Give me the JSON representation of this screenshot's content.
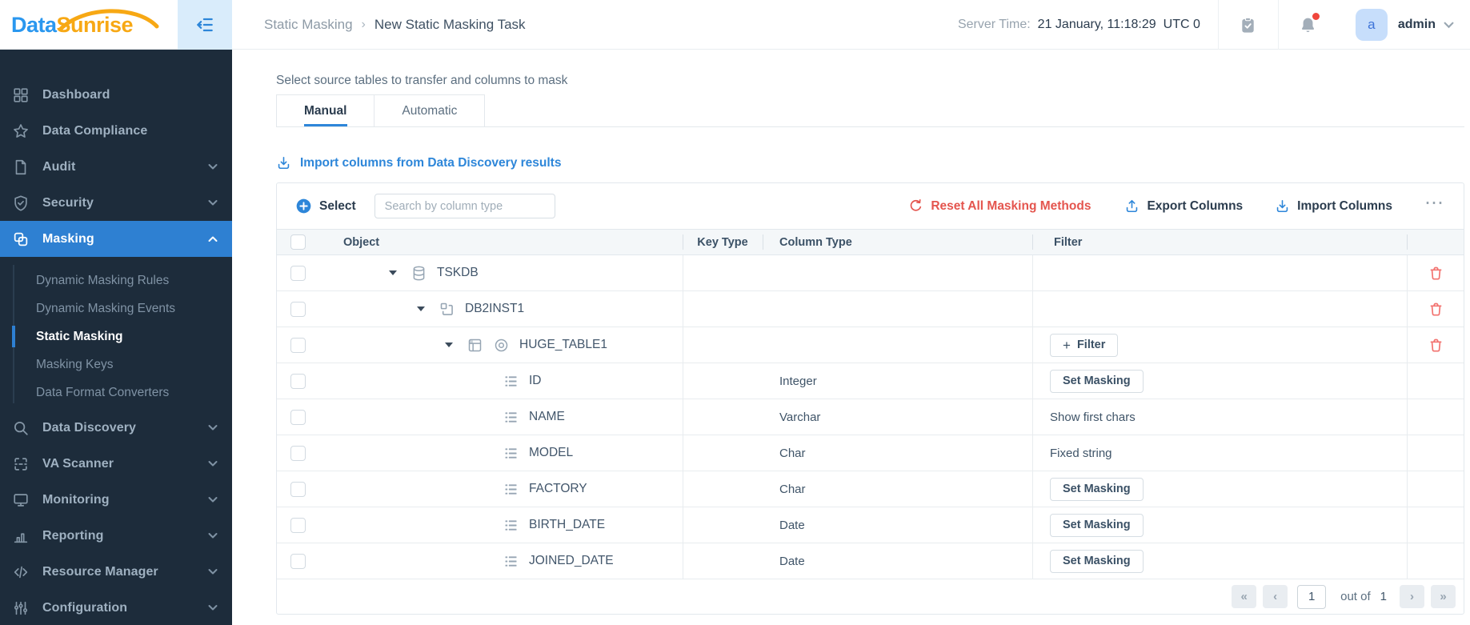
{
  "brand": {
    "word1": "Data",
    "word2": "Sunrise"
  },
  "header": {
    "breadcrumb": {
      "section": "Static Masking",
      "separator": "›",
      "page": "New Static Masking Task"
    },
    "server_time_label": "Server Time:",
    "server_time_value": "21 January, 11:18:29",
    "server_time_zone": "UTC 0",
    "user": {
      "avatar_letter": "a",
      "name": "admin"
    }
  },
  "sidebar": {
    "items": [
      {
        "label": "Dashboard",
        "icon": "dashboard"
      },
      {
        "label": "Data Compliance",
        "icon": "star"
      },
      {
        "label": "Audit",
        "icon": "document",
        "chevron": "down"
      },
      {
        "label": "Security",
        "icon": "shield",
        "chevron": "down"
      },
      {
        "label": "Masking",
        "icon": "masking",
        "chevron": "up",
        "active": true,
        "submenu": [
          {
            "label": "Dynamic Masking Rules"
          },
          {
            "label": "Dynamic Masking Events"
          },
          {
            "label": "Static Masking",
            "active": true
          },
          {
            "label": "Masking Keys"
          },
          {
            "label": "Data Format Converters"
          }
        ]
      },
      {
        "label": "Data Discovery",
        "icon": "search",
        "chevron": "down"
      },
      {
        "label": "VA Scanner",
        "icon": "scanner",
        "chevron": "down"
      },
      {
        "label": "Monitoring",
        "icon": "monitor",
        "chevron": "down"
      },
      {
        "label": "Reporting",
        "icon": "chart",
        "chevron": "down"
      },
      {
        "label": "Resource Manager",
        "icon": "code",
        "chevron": "down"
      },
      {
        "label": "Configuration",
        "icon": "sliders",
        "chevron": "down"
      }
    ]
  },
  "content": {
    "subtitle": "Select source tables to transfer and columns to mask",
    "tabs": [
      {
        "label": "Manual",
        "active": true
      },
      {
        "label": "Automatic",
        "active": false
      }
    ],
    "import_discovery_label": "Import columns from Data Discovery results",
    "toolbar": {
      "select_label": "Select",
      "search_placeholder": "Search by column type",
      "reset_label": "Reset All Masking Methods",
      "export_label": "Export Columns",
      "import_label": "Import Columns",
      "more_glyph": "⋯"
    },
    "table": {
      "headers": {
        "object": "Object",
        "key_type": "Key Type",
        "column_type": "Column Type",
        "filter": "Filter"
      },
      "rows": [
        {
          "kind": "database",
          "icon": "database",
          "name": "TSKDB",
          "level": 1,
          "caret": "down",
          "trash": true
        },
        {
          "kind": "schema",
          "icon": "schema",
          "name": "DB2INST1",
          "level": 2,
          "caret": "down",
          "trash": true
        },
        {
          "kind": "table",
          "icon": "table",
          "extra_icon": "eye",
          "name": "HUGE_TABLE1",
          "level": 3,
          "caret": "down",
          "trash": true,
          "filter": {
            "kind": "add-filter",
            "plus": "+",
            "label": "Filter"
          }
        },
        {
          "kind": "column",
          "icon": "columns",
          "name": "ID",
          "column_type": "Integer",
          "filter": {
            "kind": "button",
            "label": "Set Masking"
          }
        },
        {
          "kind": "column",
          "icon": "columns",
          "name": "NAME",
          "column_type": "Varchar",
          "filter": {
            "kind": "text",
            "label": "Show first chars"
          }
        },
        {
          "kind": "column",
          "icon": "columns",
          "name": "MODEL",
          "column_type": "Char",
          "filter": {
            "kind": "text",
            "label": "Fixed string"
          }
        },
        {
          "kind": "column",
          "icon": "columns",
          "name": "FACTORY",
          "column_type": "Char",
          "filter": {
            "kind": "button",
            "label": "Set Masking"
          }
        },
        {
          "kind": "column",
          "icon": "columns",
          "name": "BIRTH_DATE",
          "column_type": "Date",
          "filter": {
            "kind": "button",
            "label": "Set Masking"
          }
        },
        {
          "kind": "column",
          "icon": "columns",
          "name": "JOINED_DATE",
          "column_type": "Date",
          "filter": {
            "kind": "button",
            "label": "Set Masking"
          }
        }
      ]
    },
    "pagination": {
      "first": "«",
      "prev": "‹",
      "page": "1",
      "out_of_label": "out of",
      "total": "1",
      "next": "›",
      "last": "»"
    }
  },
  "colors": {
    "accent_blue": "#2d86d9",
    "sidebar_bg": "#1d2c3b",
    "sidebar_active": "#2e80d2",
    "danger_red": "#e4554e",
    "trash_red": "#f2716e",
    "logo_blue": "#2a97ef",
    "logo_orange": "#f7a814",
    "table_header_bg": "#f4f7f9",
    "toggle_bg": "#d9ecfb",
    "notification_dot": "#f0463c"
  }
}
